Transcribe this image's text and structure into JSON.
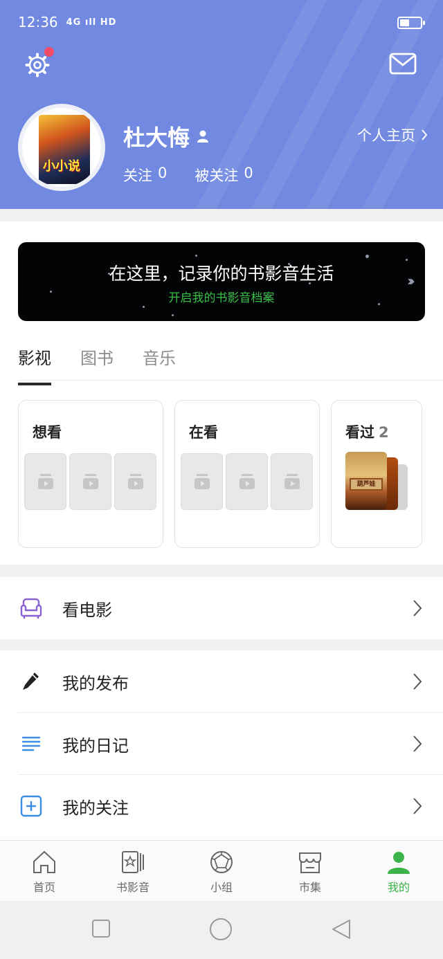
{
  "status_bar": {
    "time": "12:36",
    "signal": "4G ıll HD",
    "battery_level": 0.45
  },
  "header": {
    "username": "杜大悔",
    "following_label": "关注",
    "following_count": "0",
    "followers_label": "被关注",
    "followers_count": "0",
    "homepage_link": "个人主页",
    "avatar_text": "小小说",
    "settings_has_notification": true,
    "colors": {
      "header_bg": "#7189e0",
      "notification_dot": "#f04c6a"
    }
  },
  "banner": {
    "headline": "在这里，记录你的书影音生活",
    "subline": "开启我的书影音档案",
    "subline_color": "#39c04a"
  },
  "tabs": [
    {
      "label": "影视",
      "active": true
    },
    {
      "label": "图书",
      "active": false
    },
    {
      "label": "音乐",
      "active": false
    }
  ],
  "cards": [
    {
      "title": "想看",
      "count": ""
    },
    {
      "title": "在看",
      "count": ""
    },
    {
      "title": "看过",
      "count": "2"
    }
  ],
  "poster_text": "葫芦娃",
  "menu_top": [
    {
      "label": "看电影",
      "icon": "armchair-icon",
      "icon_color": "#8a63d2"
    }
  ],
  "menu_list": [
    {
      "label": "我的发布",
      "icon": "pencil-icon",
      "icon_color": "#222222"
    },
    {
      "label": "我的日记",
      "icon": "lines-icon",
      "icon_color": "#3a8de0"
    },
    {
      "label": "我的关注",
      "icon": "plus-box-icon",
      "icon_color": "#3a8de0"
    }
  ],
  "bottom_nav": [
    {
      "label": "首页",
      "icon": "home-icon",
      "active": false
    },
    {
      "label": "书影音",
      "icon": "media-icon",
      "active": false
    },
    {
      "label": "小组",
      "icon": "group-icon",
      "active": false
    },
    {
      "label": "市集",
      "icon": "market-icon",
      "active": false
    },
    {
      "label": "我的",
      "icon": "profile-icon",
      "active": true
    }
  ],
  "accent_active": "#3cb34a"
}
